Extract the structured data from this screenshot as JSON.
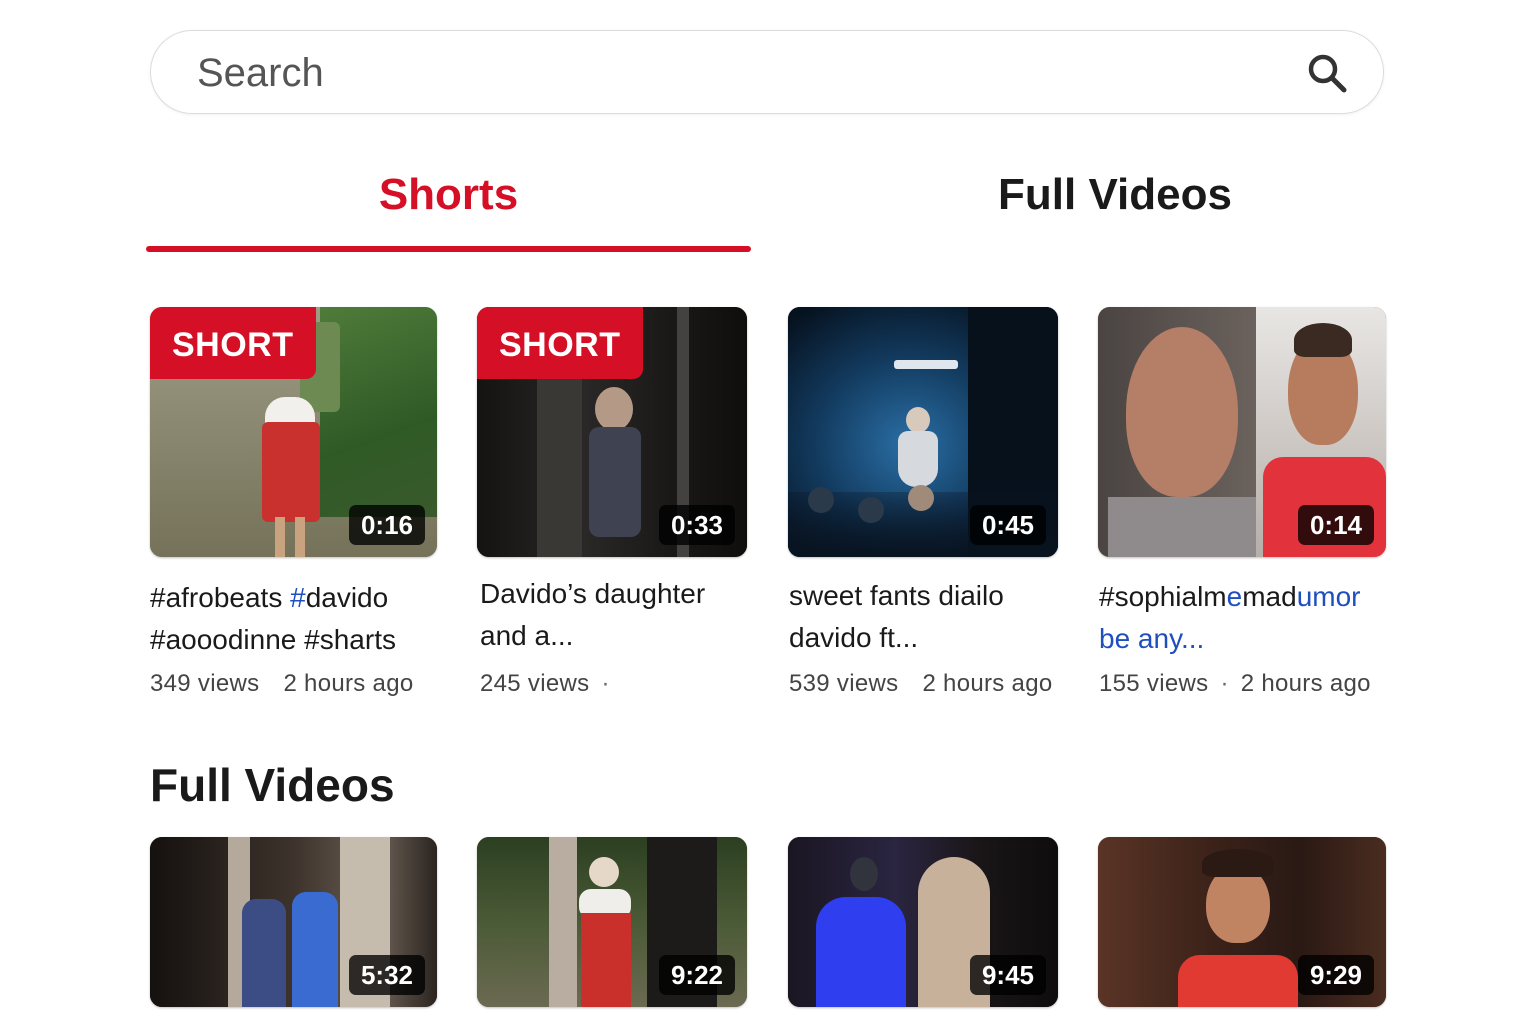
{
  "search": {
    "placeholder": "Search"
  },
  "tabs": [
    {
      "label": "Shorts",
      "active": true
    },
    {
      "label": "Full Videos",
      "active": false
    }
  ],
  "colors": {
    "accent": "#d50f25",
    "link": "#1f4fbf"
  },
  "shorts": [
    {
      "badge": "SHORT",
      "duration": "0:16",
      "title_parts": [
        "#afrobeats ",
        "#",
        "davido",
        " #aooodinne #sharts"
      ],
      "views": "349 views",
      "time": "2 hours ago"
    },
    {
      "badge": "SHORT",
      "duration": "0:33",
      "title": "Davido’s daughter and a...",
      "views": "245 views",
      "time": ""
    },
    {
      "duration": "0:45",
      "title": "sweet fants diailo davido ft...",
      "views": "539 views",
      "time": "2 hours ago"
    },
    {
      "duration": "0:14",
      "title_parts": [
        "#sophialm",
        "e",
        "mad",
        "umor",
        "be any..."
      ],
      "views": "155 views",
      "time": "2 hours ago"
    }
  ],
  "full_videos": {
    "heading": "Full Videos",
    "items": [
      {
        "duration": "5:32"
      },
      {
        "duration": "9:22"
      },
      {
        "duration": "9:45"
      },
      {
        "duration": "9:29"
      }
    ]
  }
}
